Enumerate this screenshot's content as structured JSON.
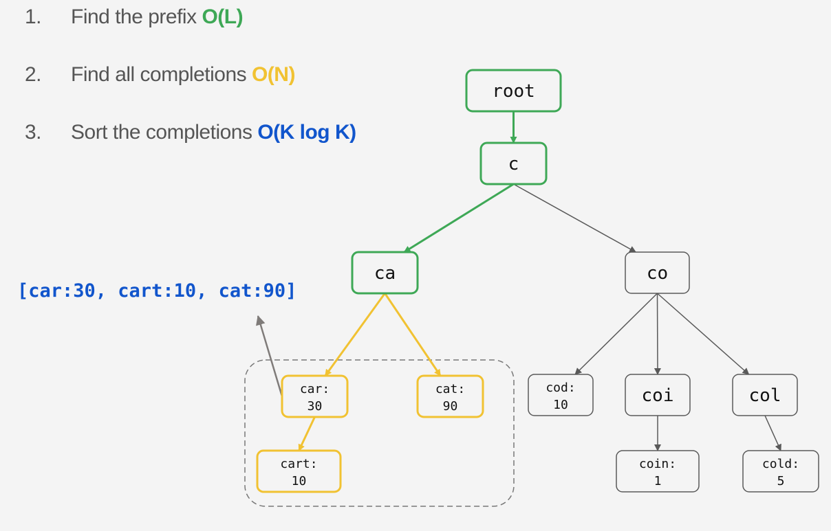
{
  "steps": [
    {
      "number": "1.",
      "text": "Find the prefix ",
      "complexity": "O(L)",
      "color": "#3ea856"
    },
    {
      "number": "2.",
      "text": "Find all completions ",
      "complexity": "O(N)",
      "color": "#f1c232"
    },
    {
      "number": "3.",
      "text": "Sort the completions ",
      "complexity": "O(K log K)",
      "color": "#1155cc"
    }
  ],
  "result_list": "[car:30, cart:10, cat:90]",
  "colors": {
    "prefix": "#3ea856",
    "completions": "#f1c232",
    "sorted": "#1155cc",
    "default": "#595959",
    "result_arrow": "#7f7b79"
  },
  "trie": {
    "nodes": [
      {
        "id": "root",
        "line1": "root",
        "line2": "",
        "state": "prefix"
      },
      {
        "id": "c",
        "line1": "c",
        "line2": "",
        "state": "prefix"
      },
      {
        "id": "ca",
        "line1": "ca",
        "line2": "",
        "state": "prefix"
      },
      {
        "id": "co",
        "line1": "co",
        "line2": "",
        "state": "default"
      },
      {
        "id": "car",
        "line1": "car:",
        "line2": "30",
        "state": "completion"
      },
      {
        "id": "cat",
        "line1": "cat:",
        "line2": "90",
        "state": "completion"
      },
      {
        "id": "cart",
        "line1": "cart:",
        "line2": "10",
        "state": "completion"
      },
      {
        "id": "cod",
        "line1": "cod:",
        "line2": "10",
        "state": "default"
      },
      {
        "id": "coi",
        "line1": "coi",
        "line2": "",
        "state": "default"
      },
      {
        "id": "col",
        "line1": "col",
        "line2": "",
        "state": "default"
      },
      {
        "id": "coin",
        "line1": "coin:",
        "line2": "1",
        "state": "default"
      },
      {
        "id": "cold",
        "line1": "cold:",
        "line2": "5",
        "state": "default"
      }
    ],
    "edges": [
      {
        "from": "root",
        "to": "c",
        "state": "prefix"
      },
      {
        "from": "c",
        "to": "ca",
        "state": "prefix"
      },
      {
        "from": "c",
        "to": "co",
        "state": "default"
      },
      {
        "from": "ca",
        "to": "car",
        "state": "completion"
      },
      {
        "from": "ca",
        "to": "cat",
        "state": "completion"
      },
      {
        "from": "car",
        "to": "cart",
        "state": "completion"
      },
      {
        "from": "co",
        "to": "cod",
        "state": "default"
      },
      {
        "from": "co",
        "to": "coi",
        "state": "default"
      },
      {
        "from": "co",
        "to": "col",
        "state": "default"
      },
      {
        "from": "coi",
        "to": "coin",
        "state": "default"
      },
      {
        "from": "col",
        "to": "cold",
        "state": "default"
      }
    ]
  }
}
